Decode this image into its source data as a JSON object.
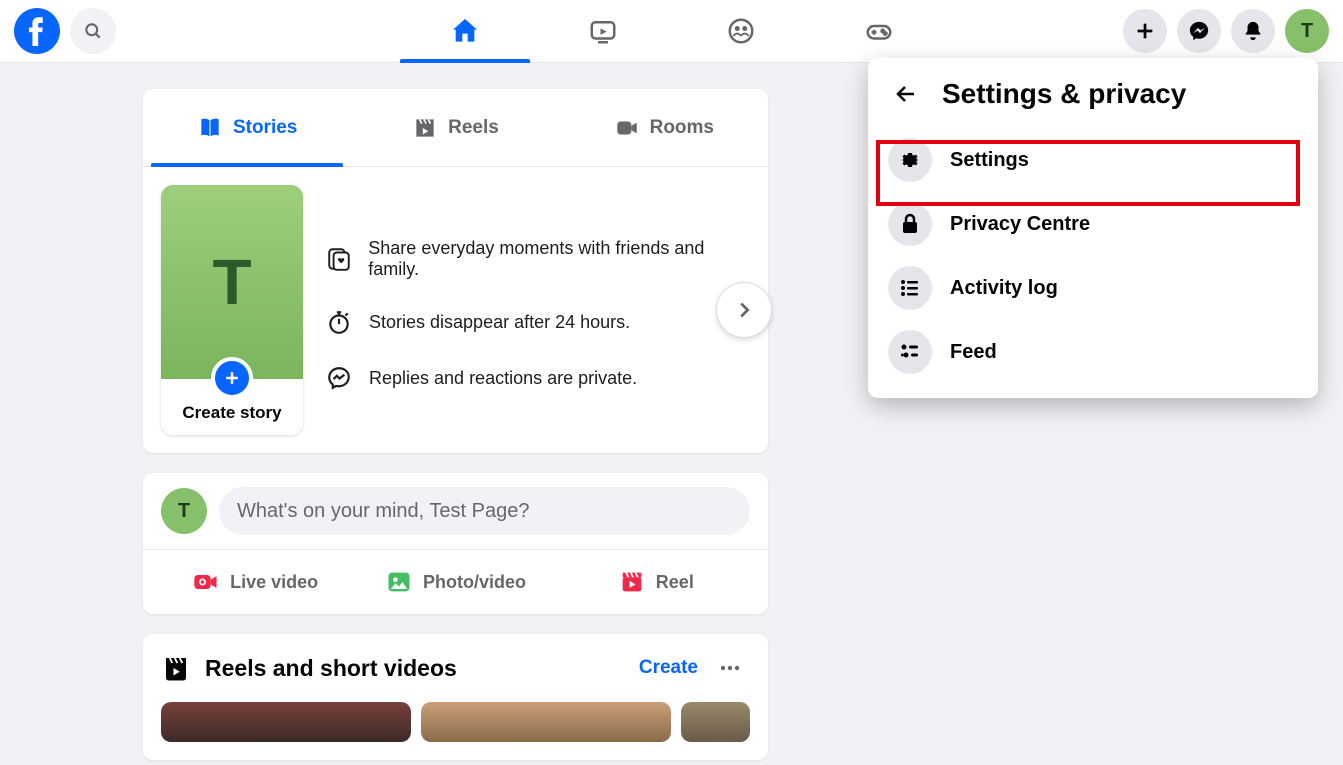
{
  "profile_initial": "T",
  "nav": {
    "active": "home"
  },
  "stories": {
    "tabs": [
      "Stories",
      "Reels",
      "Rooms"
    ],
    "create_label": "Create story",
    "info": [
      "Share everyday moments with friends and family.",
      "Stories disappear after 24 hours.",
      "Replies and reactions are private."
    ]
  },
  "composer": {
    "placeholder": "What's on your mind, Test Page?",
    "actions": {
      "live": "Live video",
      "photo": "Photo/video",
      "reel": "Reel"
    }
  },
  "reels": {
    "title": "Reels and short videos",
    "create": "Create"
  },
  "dropdown": {
    "title": "Settings & privacy",
    "items": [
      {
        "icon": "gear",
        "label": "Settings"
      },
      {
        "icon": "lock",
        "label": "Privacy Centre"
      },
      {
        "icon": "list",
        "label": "Activity log"
      },
      {
        "icon": "feed",
        "label": "Feed"
      }
    ]
  }
}
